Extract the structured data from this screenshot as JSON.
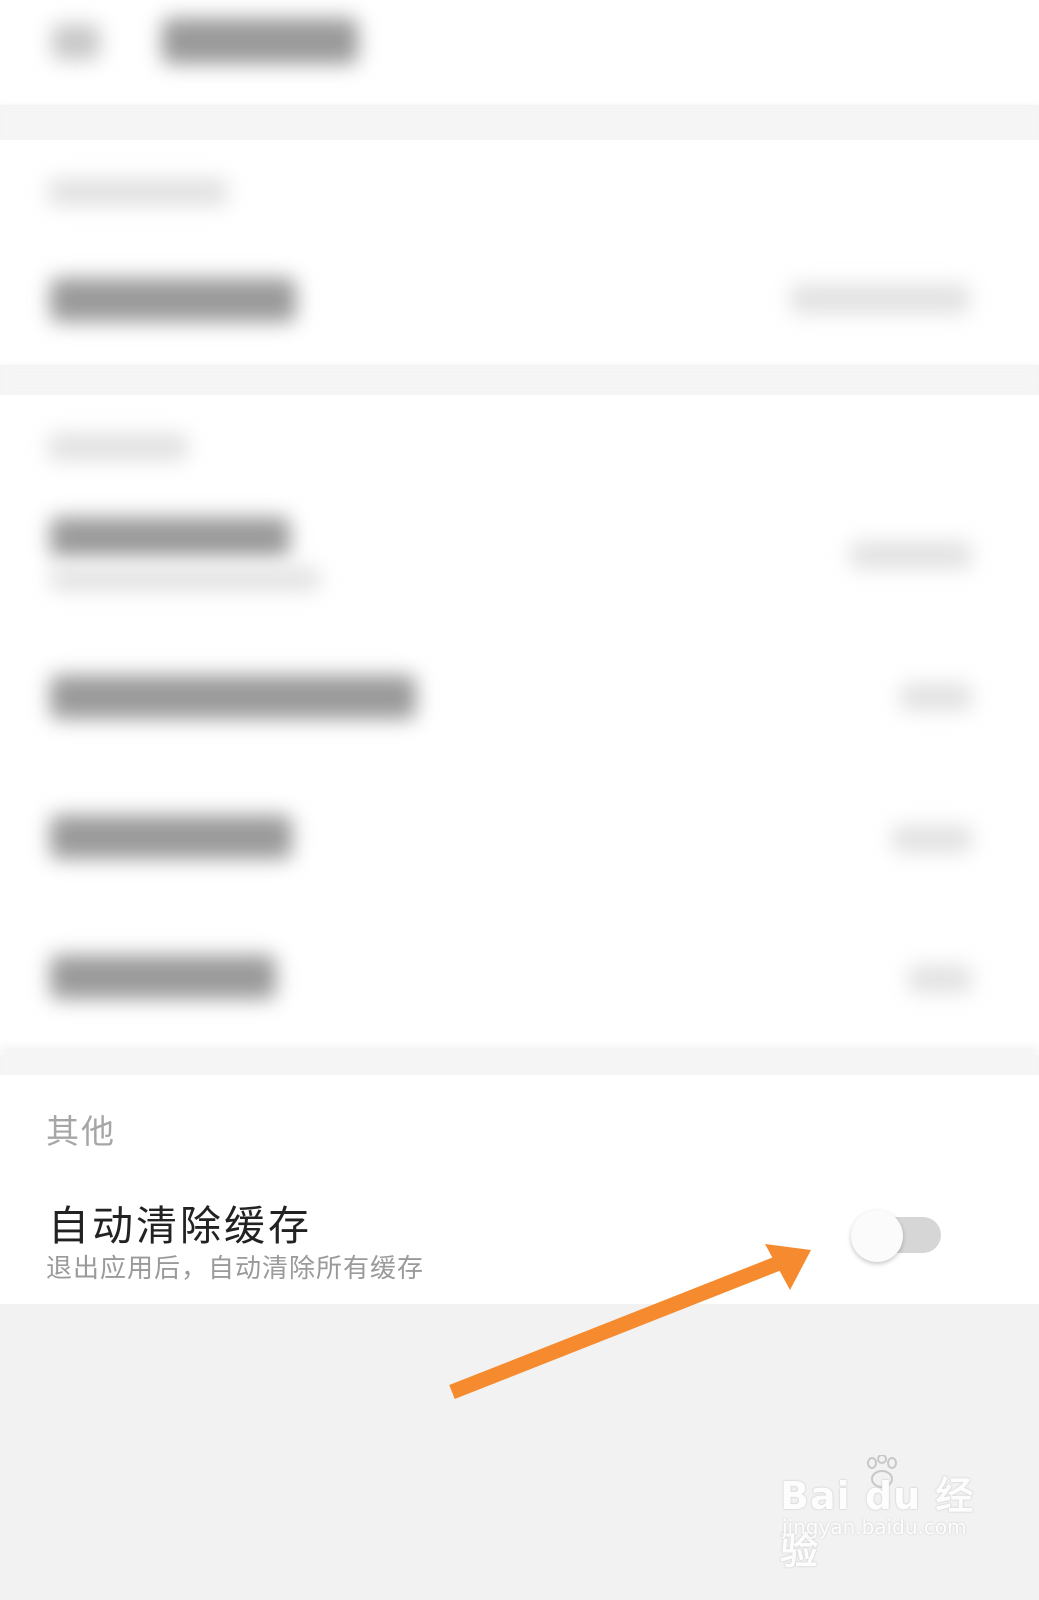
{
  "section": {
    "title": "其他"
  },
  "setting": {
    "title": "自动清除缓存",
    "description": "退出应用后，自动清除所有缓存",
    "toggle_state": "off"
  },
  "watermark": {
    "logo_text": "Bai du 经验",
    "url": "jingyan.baidu.com"
  },
  "colors": {
    "arrow": "#f58a2f",
    "toggle_track": "#d6d6d6",
    "section_title": "#a6a6a6"
  },
  "icons": {
    "arrow": "arrow-annotation-icon",
    "paw": "baidu-paw-icon"
  }
}
